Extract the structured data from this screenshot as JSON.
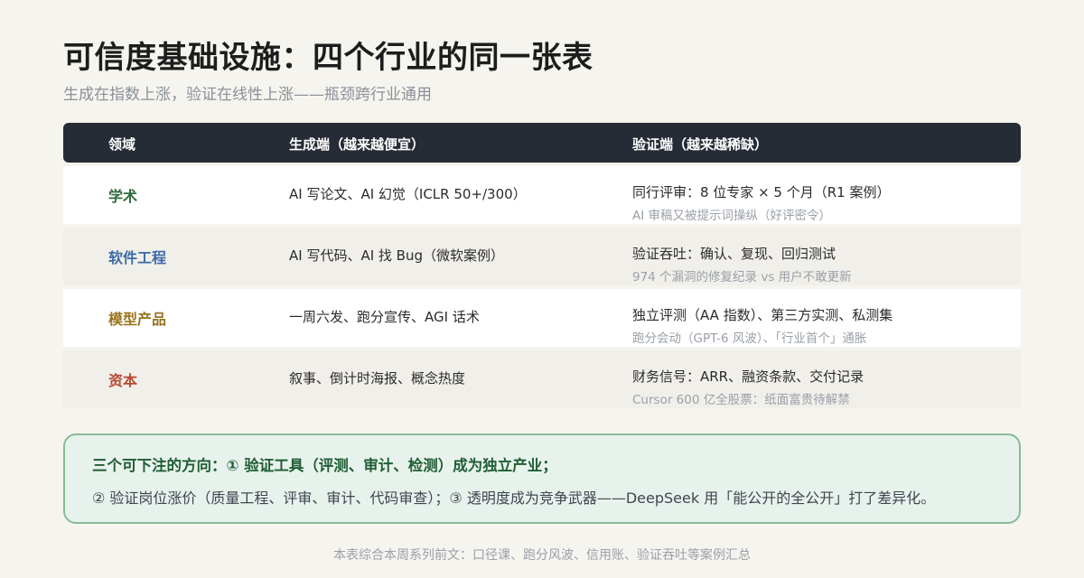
{
  "header": {
    "title": "可信度基础设施：四个行业的同一张表",
    "subtitle": "生成在指数上涨，验证在线性上涨——瓶颈跨行业通用"
  },
  "table": {
    "columns": [
      "领域",
      "生成端（越来越便宜）",
      "验证端（越来越稀缺）"
    ],
    "rows": [
      {
        "domain": "学术",
        "color": "#2e6b3f",
        "generation": "AI 写论文、AI 幻觉（ICLR 50+/300）",
        "verification_main": "同行评审：8 位专家 × 5 个月（R1 案例）",
        "verification_sub": "AI 审稿又被提示词操纵（好评密令）"
      },
      {
        "domain": "软件工程",
        "color": "#3b6aa8",
        "generation": "AI 写代码、AI 找 Bug（微软案例）",
        "verification_main": "验证吞吐：确认、复现、回归测试",
        "verification_sub": "974 个漏洞的修复纪录 vs 用户不敢更新"
      },
      {
        "domain": "模型产品",
        "color": "#9a7420",
        "generation": "一周六发、跑分宣传、AGI 话术",
        "verification_main": "独立评测（AA 指数）、第三方实测、私测集",
        "verification_sub": "跑分会动（GPT-6 风波）、「行业首个」通胀"
      },
      {
        "domain": "资本",
        "color": "#b84a32",
        "generation": "叙事、倒计时海报、概念热度",
        "verification_main": "财务信号：ARR、融资条款、交付记录",
        "verification_sub": "Cursor 600 亿全股票：纸面富贵待解禁"
      }
    ]
  },
  "callout": {
    "line1": "三个可下注的方向：① 验证工具（评测、审计、检测）成为独立产业；",
    "line2": "② 验证岗位涨价（质量工程、评审、审计、代码审查）；③ 透明度成为竞争武器——DeepSeek 用「能公开的全公开」打了差异化。"
  },
  "footer": "本表综合本周系列前文：口径课、跑分风波、信用账、验证吞吐等案例汇总"
}
